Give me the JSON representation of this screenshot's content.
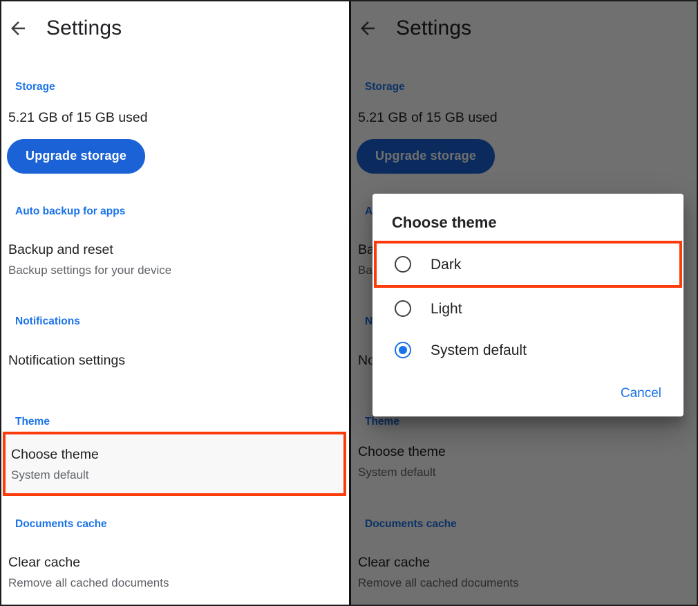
{
  "colors": {
    "accent_blue": "#1a73e8",
    "button_blue": "#1a62d6",
    "highlight_red": "#fb3b09",
    "text_primary": "#202124",
    "text_secondary": "#5f6368",
    "scrim": "rgba(0,0,0,0.56)",
    "highlight_fill": "#f8f8f8"
  },
  "appbar": {
    "back_icon": "arrow-back-icon",
    "title": "Settings"
  },
  "settings": {
    "sections": [
      {
        "header": "Storage",
        "usage_text": "5.21 GB of 15 GB used",
        "button_label": "Upgrade storage"
      },
      {
        "header": "Auto backup for apps",
        "row_title": "Backup and reset",
        "row_subtitle": "Backup settings for your device"
      },
      {
        "header": "Notifications",
        "row_title": "Notification settings",
        "row_subtitle": ""
      },
      {
        "header": "Theme",
        "row_title": "Choose theme",
        "row_subtitle": "System default"
      },
      {
        "header": "Documents cache",
        "row_title": "Clear cache",
        "row_subtitle": "Remove all cached documents"
      }
    ]
  },
  "dialog": {
    "title": "Choose theme",
    "options": [
      {
        "label": "Dark",
        "selected": false,
        "highlighted": true
      },
      {
        "label": "Light",
        "selected": false,
        "highlighted": false
      },
      {
        "label": "System default",
        "selected": true,
        "highlighted": false
      }
    ],
    "cancel_label": "Cancel"
  }
}
